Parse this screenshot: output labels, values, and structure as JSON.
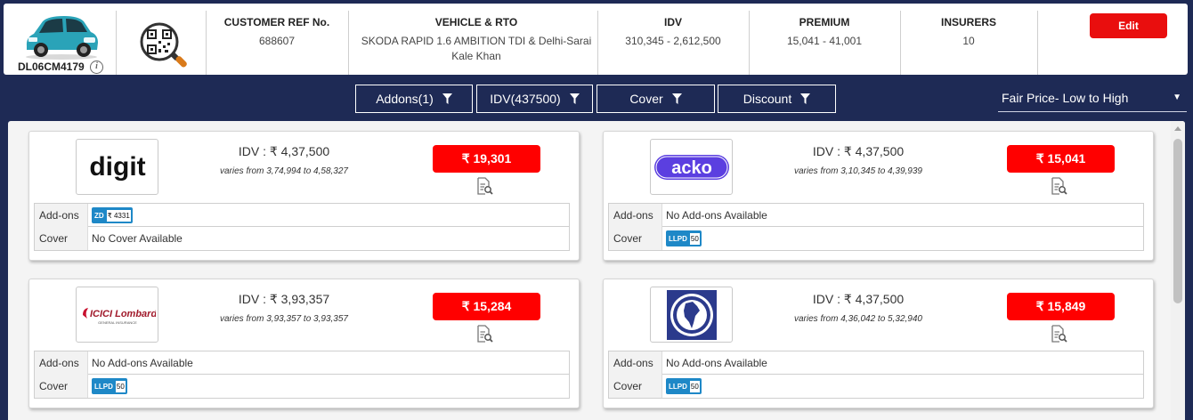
{
  "vehicle": {
    "registration": "DL06CM4179"
  },
  "header": {
    "columns": [
      {
        "label": "CUSTOMER REF No.",
        "value": "688607"
      },
      {
        "label": "VEHICLE & RTO",
        "value": "SKODA RAPID 1.6 AMBITION TDI & Delhi-Sarai Kale Khan"
      },
      {
        "label": "IDV",
        "value": "310,345 - 2,612,500"
      },
      {
        "label": "PREMIUM",
        "value": "15,041 - 41,001"
      },
      {
        "label": "INSURERS",
        "value": "10"
      }
    ],
    "edit_label": "Edit"
  },
  "filters": [
    {
      "label": "Addons(1)"
    },
    {
      "label": "IDV(437500)"
    },
    {
      "label": "Cover"
    },
    {
      "label": "Discount"
    }
  ],
  "sort": {
    "selected": "Fair Price- Low to High"
  },
  "labels": {
    "addons": "Add-ons",
    "cover": "Cover"
  },
  "cards": [
    {
      "logo_icon": "digit-logo",
      "logo_text": "digit",
      "idv": "IDV : ₹ 4,37,500",
      "idv_range": "varies from 3,74,994 to 4,58,327",
      "premium": "₹ 19,301",
      "addons_chip": {
        "code": "ZD",
        "value": "₹ 4331"
      },
      "addons_text": null,
      "cover_chip": null,
      "cover_text": "No Cover Available"
    },
    {
      "logo_icon": "acko-logo",
      "logo_text": "acko",
      "idv": "IDV : ₹ 4,37,500",
      "idv_range": "varies from 3,10,345 to 4,39,939",
      "premium": "₹ 15,041",
      "addons_chip": null,
      "addons_text": "No Add-ons Available",
      "cover_chip": {
        "code": "LLPD",
        "value": "50"
      },
      "cover_text": null
    },
    {
      "logo_icon": "icici-lombard-logo",
      "logo_text": "ICICI Lombard",
      "logo_subtext": "GENERAL INSURANCE",
      "idv": "IDV : ₹ 3,93,357",
      "idv_range": "varies from 3,93,357 to 3,93,357",
      "premium": "₹ 15,284",
      "addons_chip": null,
      "addons_text": "No Add-ons Available",
      "cover_chip": {
        "code": "LLPD",
        "value": "50"
      },
      "cover_text": null
    },
    {
      "logo_icon": "new-india-assurance-logo",
      "idv": "IDV : ₹ 4,37,500",
      "idv_range": "varies from 4,36,042 to 5,32,940",
      "premium": "₹ 15,849",
      "addons_chip": null,
      "addons_text": "No Add-ons Available",
      "cover_chip": {
        "code": "LLPD",
        "value": "50"
      },
      "cover_text": null
    }
  ],
  "colors": {
    "background": "#1e2a55",
    "accent_red": "#f00000",
    "chip_blue": "#1e88c7",
    "acko_purple": "#5b3fe0"
  }
}
